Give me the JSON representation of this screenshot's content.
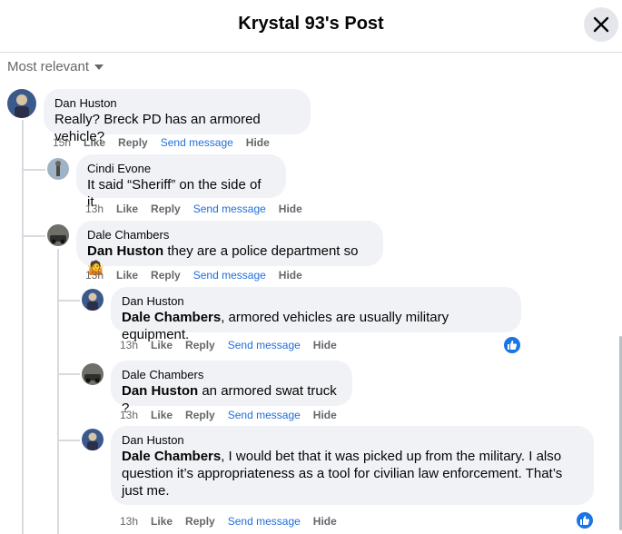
{
  "header": {
    "title": "Krystal 93's Post"
  },
  "sort": {
    "label": "Most relevant"
  },
  "comments": [
    {
      "author": "Dan Huston",
      "mention": "",
      "text": "Really? Breck PD has an armored vehicle?",
      "time": "15h",
      "like": "Like",
      "reply": "Reply",
      "send": "Send message",
      "hide": "Hide"
    },
    {
      "author": "Cindi Evone",
      "mention": "",
      "text": "It said “Sheriff” on the side of it.",
      "time": "13h",
      "like": "Like",
      "reply": "Reply",
      "send": "Send message",
      "hide": "Hide"
    },
    {
      "author": "Dale Chambers",
      "mention": "Dan Huston",
      "text": " they are a police department so 🤷",
      "time": "13h",
      "like": "Like",
      "reply": "Reply",
      "send": "Send message",
      "hide": "Hide"
    },
    {
      "author": "Dan Huston",
      "mention": "Dale Chambers",
      "text": ", armored vehicles are usually military equipment.",
      "time": "13h",
      "like": "Like",
      "reply": "Reply",
      "send": "Send message",
      "hide": "Hide"
    },
    {
      "author": "Dale Chambers",
      "mention": "Dan Huston",
      "text": " an armored swat truck ?",
      "time": "13h",
      "like": "Like",
      "reply": "Reply",
      "send": "Send message",
      "hide": "Hide"
    },
    {
      "author": "Dan Huston",
      "mention": "Dale Chambers",
      "text": ", I would bet that it was picked up from the military. I also question it’s appropriateness as a tool for civilian law enforcement. That’s just me.",
      "time": "13h",
      "like": "Like",
      "reply": "Reply",
      "send": "Send message",
      "hide": "Hide"
    }
  ],
  "icons": {
    "close": "close-icon",
    "like_reaction": "thumbs-up-icon",
    "sort_caret": "caret-down-icon"
  },
  "colors": {
    "link": "#216fdb",
    "bubble": "#f0f2f5",
    "reaction": "#1b74e4"
  }
}
